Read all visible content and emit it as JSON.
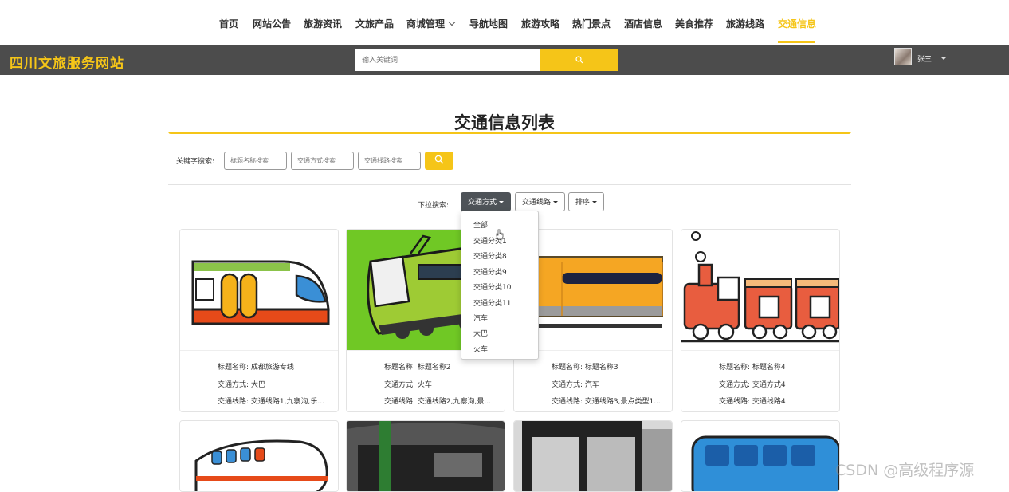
{
  "nav": {
    "items": [
      "首页",
      "网站公告",
      "旅游资讯",
      "文旅产品",
      "商城管理",
      "导航地图",
      "旅游攻略",
      "热门景点",
      "酒店信息",
      "美食推荐",
      "旅游线路",
      "交通信息"
    ],
    "active_index": 11,
    "active_color": "#f5c518"
  },
  "header": {
    "site_title": "四川文旅服务网站",
    "search_placeholder": "输入关键词",
    "username": "张三",
    "bar_color": "#4c4c4c",
    "accent_color": "#f5c518"
  },
  "main": {
    "title": "交通信息列表",
    "keyword_label": "关键字搜索:",
    "keyword_placeholders": [
      "标题名称搜索",
      "交通方式搜索",
      "交通线路搜索"
    ],
    "dropdown_label": "下拉搜索:",
    "dropdowns": [
      "交通方式",
      "交通线路",
      "排序"
    ],
    "open_dropdown_items": [
      "全部",
      "交通分类1",
      "交通分类8",
      "交通分类9",
      "交通分类10",
      "交通分类11",
      "汽车",
      "大巴",
      "火车"
    ]
  },
  "cards": [
    {
      "title_label": "标题名称: 成都旅游专线",
      "mode_label": "交通方式: 大巴",
      "route_label": "交通线路: 交通线路1,九寨沟,乐..."
    },
    {
      "title_label": "标题名称: 标题名称2",
      "mode_label": "交通方式: 火车",
      "route_label": "交通线路: 交通线路2,九寨沟,景..."
    },
    {
      "title_label": "标题名称: 标题名称3",
      "mode_label": "交通方式: 汽车",
      "route_label": "交通线路: 交通线路3,景点类型1..."
    },
    {
      "title_label": "标题名称: 标题名称4",
      "mode_label": "交通方式: 交通方式4",
      "route_label": "交通线路: 交通线路4"
    }
  ],
  "watermark": "CSDN @高级程序源"
}
